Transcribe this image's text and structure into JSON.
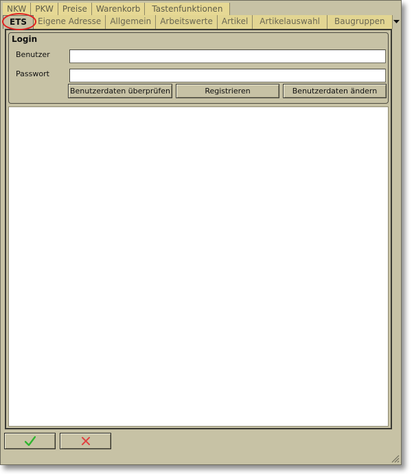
{
  "tabs_back": [
    "NKW",
    "PKW",
    "Preise",
    "Warenkorb",
    "Tastenfunktionen"
  ],
  "tabs_front": [
    "ETS",
    "Eigene Adresse",
    "Allgemein",
    "Arbeitswerte",
    "Artikel",
    "Artikelauswahl",
    "Baugruppen"
  ],
  "active_tab": "ETS",
  "login": {
    "title": "Login",
    "user_label": "Benutzer",
    "user_value": "",
    "password_label": "Passwort",
    "password_value": "",
    "check_button": "Benutzerdaten überprüfen",
    "register_button": "Registrieren",
    "change_button": "Benutzerdaten ändern"
  },
  "icons": {
    "ok": "checkmark-icon",
    "cancel": "cross-icon",
    "more_tabs": "chevron-down-icon",
    "resize": "resize-grip-icon"
  },
  "colors": {
    "panel": "#c7c2a5",
    "tab": "#e2d592",
    "annotation": "#e02020",
    "ok_green": "#2fb52f",
    "cancel_red": "#e04040"
  }
}
